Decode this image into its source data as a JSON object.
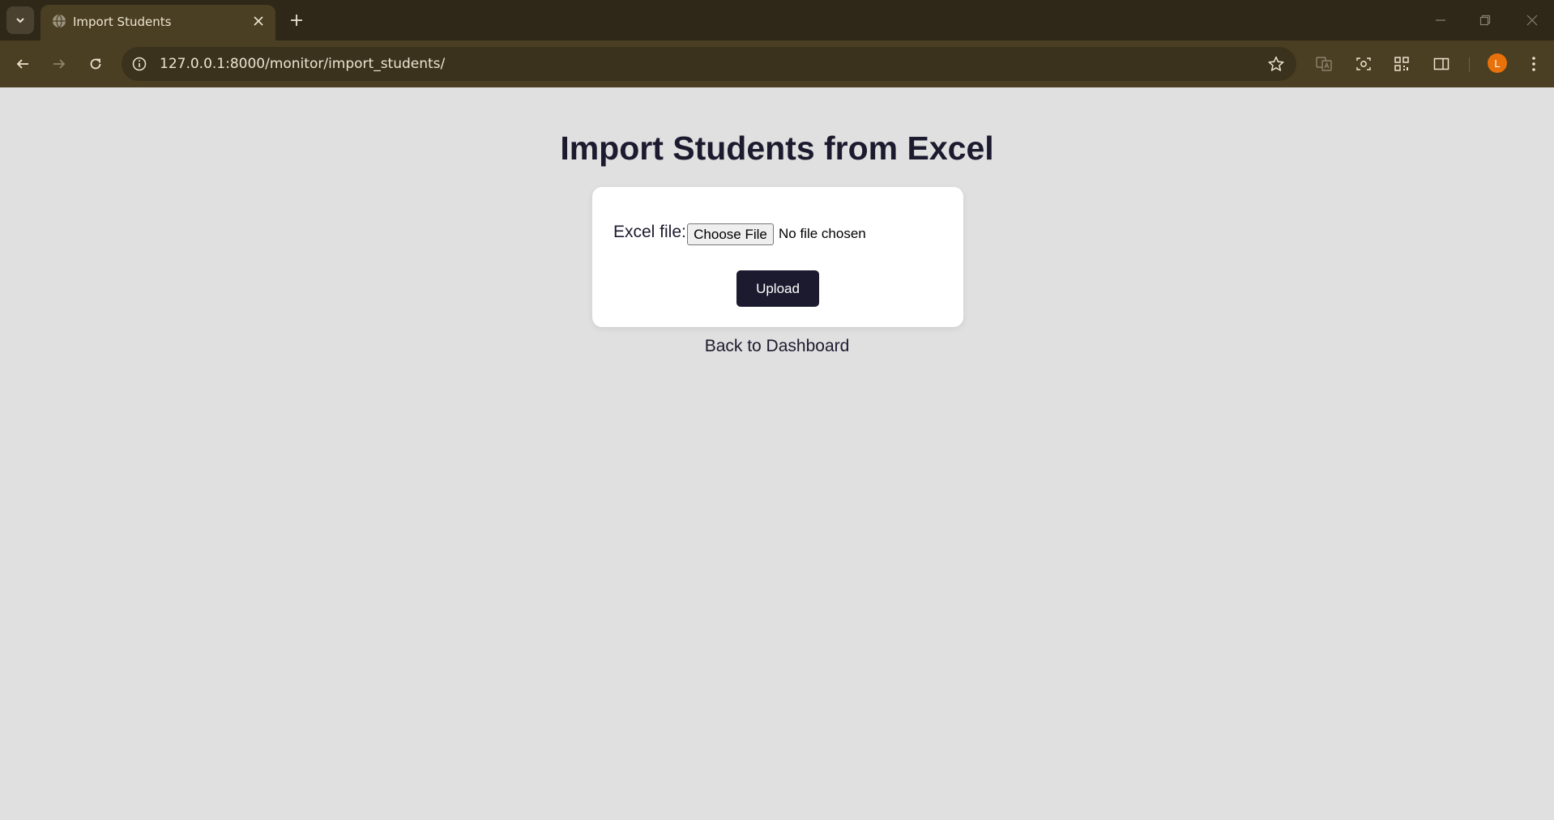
{
  "browser": {
    "tab_title": "Import Students",
    "url": "127.0.0.1:8000/monitor/import_students/",
    "profile_initial": "L",
    "icons": {
      "tab_list": "chevron-down-icon",
      "favicon": "globe-icon",
      "tab_close": "close-icon",
      "new_tab": "plus-icon",
      "back": "arrow-left-icon",
      "forward": "arrow-right-icon",
      "reload": "reload-icon",
      "site_info": "info-icon",
      "bookmark": "star-icon",
      "translate": "translate-icon",
      "screenshot": "camera-icon",
      "qr": "qr-code-icon",
      "side_panel": "side-panel-icon",
      "menu": "more-vertical-icon"
    },
    "colors": {
      "frame": "#2f2819",
      "toolbar": "#4a3f22",
      "profile": "#e8710a"
    }
  },
  "page": {
    "heading": "Import Students from Excel",
    "form": {
      "field_label": "Excel file:",
      "file_button": "Choose File",
      "file_status": "No file chosen",
      "submit_label": "Upload"
    },
    "back_link": "Back to Dashboard",
    "colors": {
      "background": "#e0e0e0",
      "card": "#ffffff",
      "button": "#1b1a2e",
      "text": "#1c1a2e"
    }
  }
}
